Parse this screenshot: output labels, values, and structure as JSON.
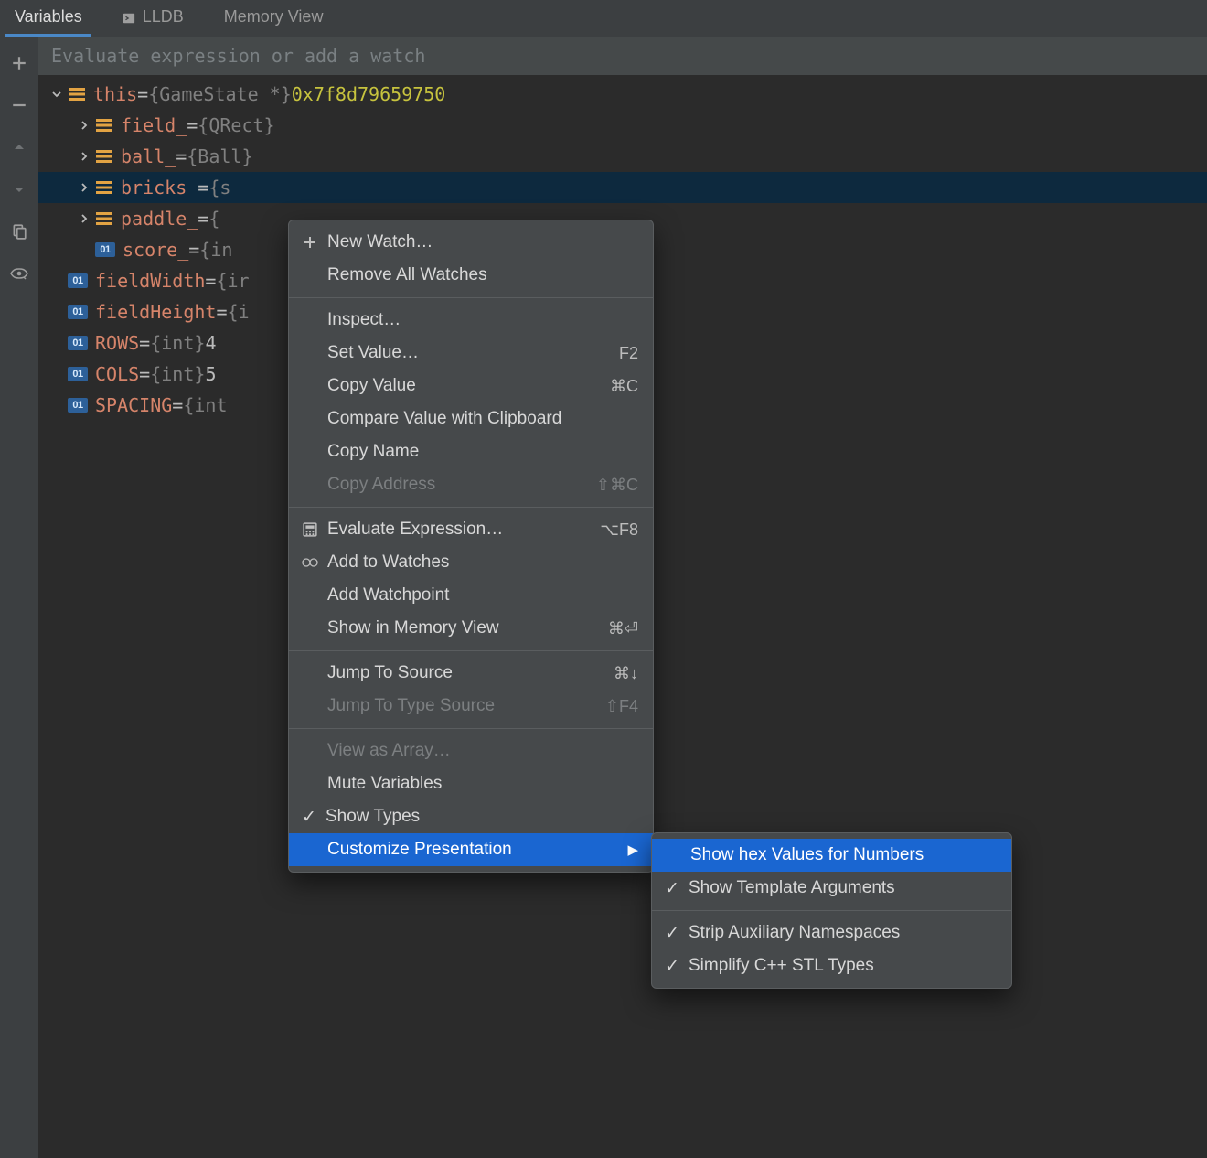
{
  "tabs": [
    {
      "label": "Variables",
      "active": true
    },
    {
      "label": "LLDB",
      "active": false
    },
    {
      "label": "Memory View",
      "active": false
    }
  ],
  "watch_placeholder": "Evaluate expression or add a watch",
  "variables": [
    {
      "depth": 0,
      "arrow": "down",
      "icon": "struct",
      "name": "this",
      "eq": " = ",
      "type": "{GameState *} ",
      "addr": "0x7f8d79659750",
      "sel": false
    },
    {
      "depth": 1,
      "arrow": "right",
      "icon": "struct",
      "name": "field_",
      "eq": " = ",
      "type": "{QRect}",
      "sel": false
    },
    {
      "depth": 1,
      "arrow": "right",
      "icon": "struct",
      "name": "ball_",
      "eq": " = ",
      "type": "{Ball}",
      "sel": false
    },
    {
      "depth": 1,
      "arrow": "right",
      "icon": "struct",
      "name": "bricks_",
      "eq": " = ",
      "type": "{s",
      "sel": true
    },
    {
      "depth": 1,
      "arrow": "right",
      "icon": "struct",
      "name": "paddle_",
      "eq": " = ",
      "type": "{",
      "sel": false
    },
    {
      "depth": 1,
      "arrow": "none",
      "icon": "prim",
      "name": "score_",
      "eq": " = ",
      "type": "{in",
      "sel": false
    },
    {
      "depth": 0,
      "arrow": "none",
      "icon": "prim",
      "name": "fieldWidth",
      "eq": " = ",
      "type": "{ir",
      "sel": false
    },
    {
      "depth": 0,
      "arrow": "none",
      "icon": "prim",
      "name": "fieldHeight",
      "eq": " = ",
      "type": "{i",
      "sel": false
    },
    {
      "depth": 0,
      "arrow": "none",
      "icon": "prim",
      "name": "ROWS",
      "eq": " = ",
      "type": "{int} ",
      "val": "4",
      "sel": false
    },
    {
      "depth": 0,
      "arrow": "none",
      "icon": "prim",
      "name": "COLS",
      "eq": " = ",
      "type": "{int} ",
      "val": "5",
      "sel": false
    },
    {
      "depth": 0,
      "arrow": "none",
      "icon": "prim",
      "name": "SPACING",
      "eq": " = ",
      "type": "{int",
      "sel": false
    }
  ],
  "prim_badge": "01",
  "context_menu": [
    {
      "kind": "item",
      "label": "New Watch…",
      "icon": "plus"
    },
    {
      "kind": "item",
      "label": "Remove All Watches"
    },
    {
      "kind": "sep"
    },
    {
      "kind": "item",
      "label": "Inspect…"
    },
    {
      "kind": "item",
      "label": "Set Value…",
      "shortcut": "F2"
    },
    {
      "kind": "item",
      "label": "Copy Value",
      "shortcut": "⌘C"
    },
    {
      "kind": "item",
      "label": "Compare Value with Clipboard"
    },
    {
      "kind": "item",
      "label": "Copy Name"
    },
    {
      "kind": "item",
      "label": "Copy Address",
      "shortcut": "⇧⌘C",
      "disabled": true
    },
    {
      "kind": "sep"
    },
    {
      "kind": "item",
      "label": "Evaluate Expression…",
      "shortcut": "⌥F8",
      "icon": "calc"
    },
    {
      "kind": "item",
      "label": "Add to Watches",
      "icon": "watches"
    },
    {
      "kind": "item",
      "label": "Add Watchpoint"
    },
    {
      "kind": "item",
      "label": "Show in Memory View",
      "shortcut": "⌘⏎"
    },
    {
      "kind": "sep"
    },
    {
      "kind": "item",
      "label": "Jump To Source",
      "shortcut": "⌘↓"
    },
    {
      "kind": "item",
      "label": "Jump To Type Source",
      "shortcut": "⇧F4",
      "disabled": true
    },
    {
      "kind": "sep"
    },
    {
      "kind": "item",
      "label": "View as Array…",
      "disabled": true
    },
    {
      "kind": "item",
      "label": "Mute Variables"
    },
    {
      "kind": "item",
      "label": "Show Types",
      "checked": true
    },
    {
      "kind": "item",
      "label": "Customize Presentation",
      "submenu": true,
      "highlight": true
    }
  ],
  "submenu": [
    {
      "label": "Show hex Values for Numbers",
      "highlight": true
    },
    {
      "label": "Show Template Arguments",
      "checked": true
    },
    {
      "kind": "sep"
    },
    {
      "label": "Strip Auxiliary Namespaces",
      "checked": true
    },
    {
      "label": "Simplify C++ STL Types",
      "checked": true
    }
  ]
}
